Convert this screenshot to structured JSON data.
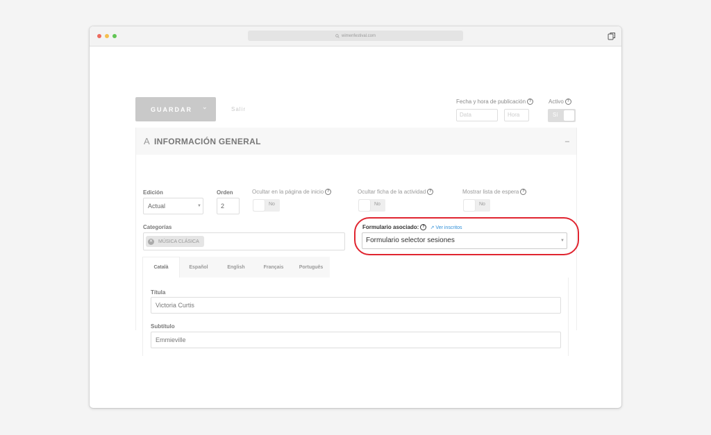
{
  "browser": {
    "url": "wimenfestival.com",
    "colors": {
      "close": "#ec6a5e",
      "minimize": "#f4bf4f",
      "maximize": "#61c554"
    }
  },
  "toolbar": {
    "save_label": "GUARDAR",
    "save_dropdown_icon": "chevron-down-icon",
    "exit_label": "Salir",
    "publication_label": "Fecha y hora de publicación",
    "date_placeholder": "Data",
    "hour_placeholder": "Hora",
    "active_label": "Activo",
    "active_value": "Sí"
  },
  "section": {
    "icon": "font-icon",
    "title": "INFORMACIÓN GENERAL",
    "collapse": "–"
  },
  "fields": {
    "edition_label": "Edición",
    "edition_value": "Actual",
    "order_label": "Orden",
    "order_value": "2",
    "hide_home_label": "Ocultar en la página de inicio",
    "hide_home_value": "No",
    "hide_activity_label": "Ocultar ficha de la actividad",
    "hide_activity_value": "No",
    "waitlist_label": "Mostrar lista de espera",
    "waitlist_value": "No",
    "categories_label": "Categorías",
    "categories": [
      "MÚSICA CLÁSICA"
    ],
    "form_label": "Formulario asociado:",
    "form_link": "Ver inscritos",
    "form_value": "Formulario selector sesiones"
  },
  "languages": {
    "tabs": [
      "Català",
      "Español",
      "English",
      "Français",
      "Português"
    ],
    "active_index": 0
  },
  "content": {
    "title_label": "Títula",
    "title_value": "Victoria Curtis",
    "subtitle_label": "Subtítulo",
    "subtitle_value": "Emmieville"
  },
  "accent": {
    "highlight": "#e0242f",
    "link": "#2f8fd8"
  }
}
